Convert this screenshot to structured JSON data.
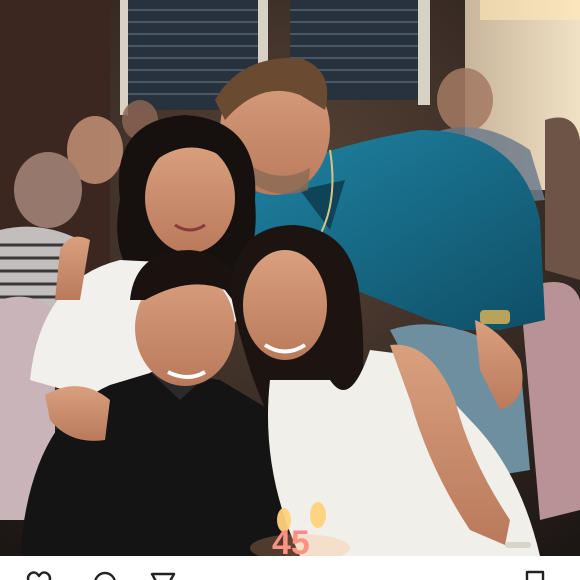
{
  "post": {
    "photo_subject": "family-birthday-dinner-photo",
    "candle_numbers": "45",
    "actions": {
      "like_icon": "heart-outline-icon",
      "comment_icon": "speech-bubble-icon",
      "share_icon": "paper-plane-icon",
      "save_icon": "bookmark-outline-icon"
    }
  },
  "colors": {
    "shirt_teal": "#1b6f8a",
    "background_warm": "#3a2b26",
    "white_dress": "#f1efea",
    "candle_flame": "#ffd27a"
  }
}
